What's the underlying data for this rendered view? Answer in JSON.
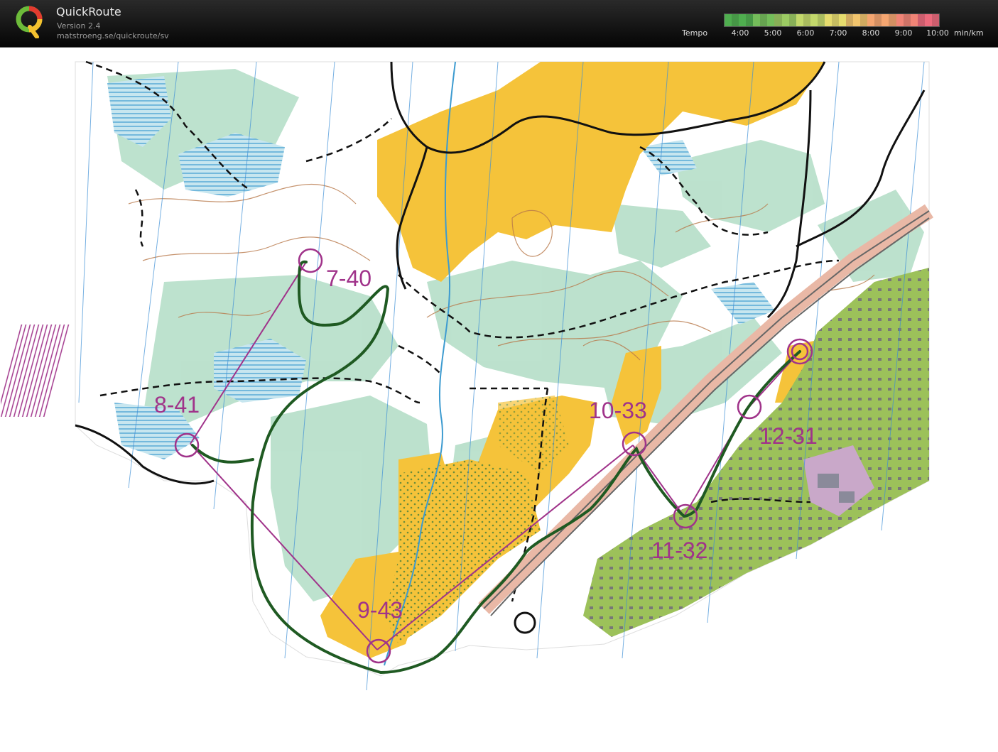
{
  "app": {
    "name": "QuickRoute",
    "version": "Version 2.4",
    "url": "matstroeng.se/quickroute/sv"
  },
  "tempo": {
    "label": "Tempo",
    "unit": "min/km",
    "ticks": [
      "4:00",
      "5:00",
      "6:00",
      "7:00",
      "8:00",
      "9:00",
      "10:00"
    ],
    "gradient_colors": [
      "#4fae4f",
      "#74bd5a",
      "#9ccb63",
      "#c3d86b",
      "#e6dc6e",
      "#f1c46d",
      "#f4a570",
      "#f08476",
      "#ec6a7c"
    ]
  },
  "map": {
    "controls": [
      {
        "label": "7-40"
      },
      {
        "label": "8-41"
      },
      {
        "label": "9-43"
      },
      {
        "label": "10-33"
      },
      {
        "label": "11-32"
      },
      {
        "label": "12-31"
      }
    ],
    "colors": {
      "course": "#a0338a",
      "route": "#1f5a22",
      "yellow_field": "#f5c33a",
      "forest": "#ffffff",
      "green_slow": "#b8e0c8",
      "water": "#4aa8d8",
      "contour": "#b8794a",
      "urban": "#8eb44a",
      "paths": "#111111"
    }
  }
}
